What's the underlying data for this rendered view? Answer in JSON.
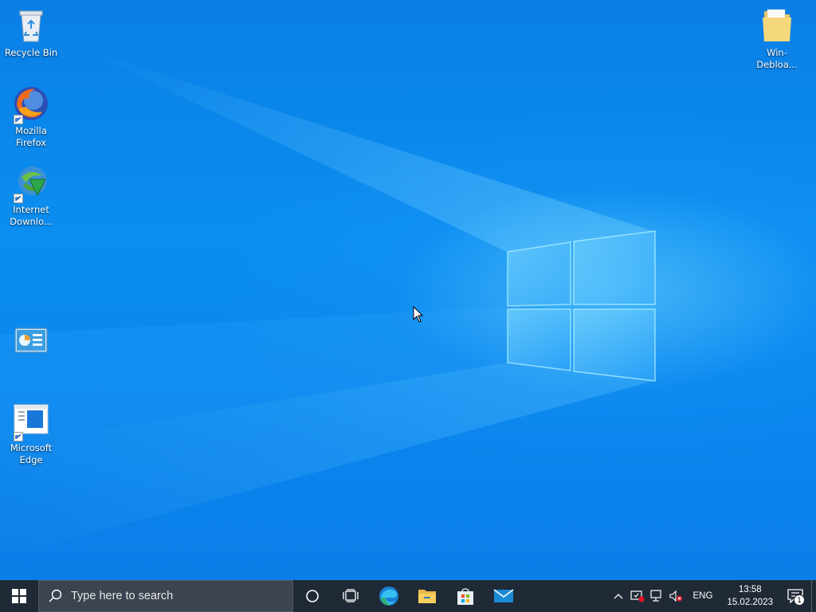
{
  "desktop": {
    "icons": [
      {
        "label": "Recycle Bin",
        "icon": "recycle-bin-icon"
      },
      {
        "label": "Mozilla Firefox",
        "icon": "firefox-icon"
      },
      {
        "label": "Internet Downlo...",
        "icon": "internet-download-manager-icon"
      },
      {
        "label": "",
        "icon": "control-panel-icon"
      },
      {
        "label": "Microsoft Edge",
        "icon": "microsoft-edge-icon"
      },
      {
        "label": "Win-Debloa...",
        "icon": "folder-icon"
      }
    ]
  },
  "taskbar": {
    "search_placeholder": "Type here to search",
    "pinned": [
      "cortana-icon",
      "task-view-icon",
      "edge-icon",
      "file-explorer-icon",
      "microsoft-store-icon",
      "mail-icon"
    ],
    "tray": {
      "language": "ENG",
      "time": "13:58",
      "date": "15.02.2023",
      "notification_count": "1"
    }
  },
  "colors": {
    "taskbar": "#1f2a36",
    "search_box": "#3b4450",
    "wallpaper_blue": "#0b8ef0"
  }
}
